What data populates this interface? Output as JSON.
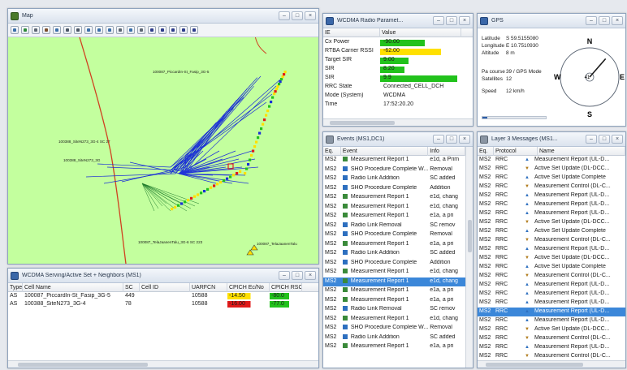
{
  "colors": {
    "map_bg": "#c3ff9e",
    "route": "#d04020",
    "rays": "#1a2fd6",
    "select": "#3b87d9",
    "good": "#22c21c",
    "warn": "#ffe000",
    "bad": "#e01a1a"
  },
  "map": {
    "title": "Map",
    "toolbar_icons": [
      "layer-icon",
      "database-icon",
      "ruler-icon",
      "gear-icon",
      "grid-icon",
      "pointer-icon",
      "select-icon",
      "zoom-in-icon",
      "zoom-out-icon",
      "fit-icon",
      "pan-icon",
      "layer-toggle-icon",
      "filter-icon",
      "play-icon",
      "forward-icon",
      "record-icon",
      "step-icon",
      "stop-icon"
    ],
    "labels": {
      "site1": "100087_PiccardIn-St_Fasip_3G-5",
      "site2": "100388_SiteN273_3G-4 SC 27",
      "site3": "100388_SiteN273_3G",
      "site4": "100087_TelaJaanenTalu_3G-6 SC 223",
      "site5": "100087_TelaJaanenTalu"
    }
  },
  "radio": {
    "title": "WCDMA Radio Paramet...",
    "headers": [
      "IE",
      "Value"
    ],
    "rows": [
      {
        "ie": "Cx Power",
        "value": "-90.00",
        "bar": 0.55,
        "color": "#22c21c"
      },
      {
        "ie": "RTBA Carrier RSSI",
        "value": "-62.00",
        "bar": 0.75,
        "color": "#ffe000"
      },
      {
        "ie": "Target SIR",
        "value": "9.00",
        "bar": 0.35,
        "color": "#22c21c"
      },
      {
        "ie": "SIR",
        "value": "8.20",
        "bar": 0.3,
        "color": "#22c21c"
      },
      {
        "ie": "SIR",
        "value": "9.9",
        "bar": 0.95,
        "color": "#22c21c"
      },
      {
        "ie": "RRC State",
        "value": "Connected_CELL_DCH",
        "bar": 0,
        "color": ""
      },
      {
        "ie": "Mode (System)",
        "value": "WCDMA",
        "bar": 0,
        "color": ""
      },
      {
        "ie": "Time",
        "value": "17:52:20.20",
        "bar": 0,
        "color": ""
      }
    ]
  },
  "gps": {
    "title": "GPS",
    "latitude_label": "Latitude",
    "latitude": "S 59.5155080",
    "longitude_label": "Longitude",
    "longitude": "E 10.7510930",
    "altitude_label": "Altitude",
    "altitude": "8 m",
    "course_label": "Pa course",
    "course": "39 / GPS Mode",
    "satellites_label": "Satellites",
    "satellites": "12",
    "speed_label": "Speed",
    "speed": "12 km/h",
    "compass": {
      "n": "N",
      "s": "S",
      "w": "W",
      "e": "E",
      "heading": "41",
      "heading_deg": 41
    }
  },
  "events": {
    "title": "Events (MS1,DC1)",
    "headers": [
      "Eq.",
      "Event",
      "Info"
    ],
    "selected_index": 13,
    "rows": [
      {
        "eq": "MS2",
        "event": "Measurement Report 1",
        "info": "e1d, a Prim",
        "icon": "#3a8a3a"
      },
      {
        "eq": "MS2",
        "event": "SHO Procedure Complete W...",
        "info": "Removal",
        "icon": "#2d6fbf"
      },
      {
        "eq": "MS2",
        "event": "Radio Link Addition",
        "info": "SC added",
        "icon": "#2d6fbf"
      },
      {
        "eq": "MS2",
        "event": "SHO Procedure Complete",
        "info": "Addition",
        "icon": "#2d6fbf"
      },
      {
        "eq": "MS2",
        "event": "Measurement Report 1",
        "info": "e1d, chang",
        "icon": "#3a8a3a"
      },
      {
        "eq": "MS2",
        "event": "Measurement Report 1",
        "info": "e1d, chang",
        "icon": "#3a8a3a"
      },
      {
        "eq": "MS2",
        "event": "Measurement Report 1",
        "info": "e1a, a pri",
        "icon": "#3a8a3a"
      },
      {
        "eq": "MS2",
        "event": "Radio Link Removal",
        "info": "SC remov",
        "icon": "#2d6fbf"
      },
      {
        "eq": "MS2",
        "event": "SHO Procedure Complete",
        "info": "Removal",
        "icon": "#2d6fbf"
      },
      {
        "eq": "MS2",
        "event": "Measurement Report 1",
        "info": "e1a, a pri",
        "icon": "#3a8a3a"
      },
      {
        "eq": "MS2",
        "event": "Radio Link Addition",
        "info": "SC added",
        "icon": "#2d6fbf"
      },
      {
        "eq": "MS2",
        "event": "SHO Procedure Complete",
        "info": "Addition",
        "icon": "#2d6fbf"
      },
      {
        "eq": "MS2",
        "event": "Measurement Report 1",
        "info": "e1d, chang",
        "icon": "#3a8a3a"
      },
      {
        "eq": "MS2",
        "event": "Measurement Report 1",
        "info": "e1d, chang",
        "icon": "#3a8a3a"
      },
      {
        "eq": "MS2",
        "event": "Measurement Report 1",
        "info": "e1a, a pri",
        "icon": "#3a8a3a"
      },
      {
        "eq": "MS2",
        "event": "Measurement Report 1",
        "info": "e1a, a pri",
        "icon": "#3a8a3a"
      },
      {
        "eq": "MS2",
        "event": "Radio Link Removal",
        "info": "SC remov",
        "icon": "#2d6fbf"
      },
      {
        "eq": "MS2",
        "event": "Measurement Report 1",
        "info": "e1d, chang",
        "icon": "#3a8a3a"
      },
      {
        "eq": "MS2",
        "event": "SHO Procedure Complete W...",
        "info": "Removal",
        "icon": "#2d6fbf"
      },
      {
        "eq": "MS2",
        "event": "Radio Link Addition",
        "info": "SC added",
        "icon": "#2d6fbf"
      },
      {
        "eq": "MS2",
        "event": "Measurement Report 1",
        "info": "e1a, a pri",
        "icon": "#3a8a3a"
      }
    ]
  },
  "layer3": {
    "title": "Layer 3 Messages (MS1...",
    "headers": [
      "Eq.",
      "Protocol",
      "Name"
    ],
    "selected_index": 17,
    "rows": [
      {
        "eq": "MS2",
        "proto": "RRC",
        "name": "Measurement Report (UL-D...",
        "dir": "up"
      },
      {
        "eq": "MS2",
        "proto": "RRC",
        "name": "Active Set Update (DL-DCC...",
        "dir": "down"
      },
      {
        "eq": "MS2",
        "proto": "RRC",
        "name": "Active Set Update Complete",
        "dir": "up"
      },
      {
        "eq": "MS2",
        "proto": "RRC",
        "name": "Measurement Control (DL-C...",
        "dir": "down"
      },
      {
        "eq": "MS2",
        "proto": "RRC",
        "name": "Measurement Report (UL-D...",
        "dir": "up"
      },
      {
        "eq": "MS2",
        "proto": "RRC",
        "name": "Measurement Report (UL-D...",
        "dir": "up"
      },
      {
        "eq": "MS2",
        "proto": "RRC",
        "name": "Measurement Report (UL-D...",
        "dir": "up"
      },
      {
        "eq": "MS2",
        "proto": "RRC",
        "name": "Active Set Update (DL-DCC...",
        "dir": "down"
      },
      {
        "eq": "MS2",
        "proto": "RRC",
        "name": "Active Set Update Complete",
        "dir": "up"
      },
      {
        "eq": "MS2",
        "proto": "RRC",
        "name": "Measurement Control (DL-C...",
        "dir": "down"
      },
      {
        "eq": "MS2",
        "proto": "RRC",
        "name": "Measurement Report (UL-D...",
        "dir": "up"
      },
      {
        "eq": "MS2",
        "proto": "RRC",
        "name": "Active Set Update (DL-DCC...",
        "dir": "down"
      },
      {
        "eq": "MS2",
        "proto": "RRC",
        "name": "Active Set Update Complete",
        "dir": "up"
      },
      {
        "eq": "MS2",
        "proto": "RRC",
        "name": "Measurement Control (DL-C...",
        "dir": "down"
      },
      {
        "eq": "MS2",
        "proto": "RRC",
        "name": "Measurement Report (UL-D...",
        "dir": "up"
      },
      {
        "eq": "MS2",
        "proto": "RRC",
        "name": "Measurement Report (UL-D...",
        "dir": "up"
      },
      {
        "eq": "MS2",
        "proto": "RRC",
        "name": "Measurement Report (UL-D...",
        "dir": "up"
      },
      {
        "eq": "MS2",
        "proto": "RRC",
        "name": "Measurement Report (UL-D...",
        "dir": "up"
      },
      {
        "eq": "MS2",
        "proto": "RRC",
        "name": "Measurement Report (UL-D...",
        "dir": "up"
      },
      {
        "eq": "MS2",
        "proto": "RRC",
        "name": "Active Set Update (DL-DCC...",
        "dir": "down"
      },
      {
        "eq": "MS2",
        "proto": "RRC",
        "name": "Measurement Control (DL-C...",
        "dir": "down"
      },
      {
        "eq": "MS2",
        "proto": "RRC",
        "name": "Measurement Report (UL-D...",
        "dir": "up"
      },
      {
        "eq": "MS2",
        "proto": "RRC",
        "name": "Measurement Control (DL-C...",
        "dir": "down"
      }
    ]
  },
  "serving": {
    "title": "WCDMA Serving/Active Set + Neighbors (MS1)",
    "headers": [
      "Type",
      "Cell Name",
      "SC",
      "Cell ID",
      "UARFCN",
      "CPICH Ec/No",
      "CPICH RSCP"
    ],
    "rows": [
      {
        "type": "AS",
        "cell": "100087_PiccardIn-St_Fasip_3G-5",
        "sc": "449",
        "cellid": "",
        "uarfcn": "10588",
        "ecno": "-14.50",
        "ecno_color": "#ffe000",
        "rscp": "-80.0",
        "rscp_color": "#22c21c"
      },
      {
        "type": "AS",
        "cell": "100388_SiteN273_3G-4",
        "sc": "78",
        "cellid": "",
        "uarfcn": "10588",
        "ecno": "-16.00",
        "ecno_color": "#e01a1a",
        "rscp": "-77.0",
        "rscp_color": "#22c21c"
      }
    ]
  }
}
